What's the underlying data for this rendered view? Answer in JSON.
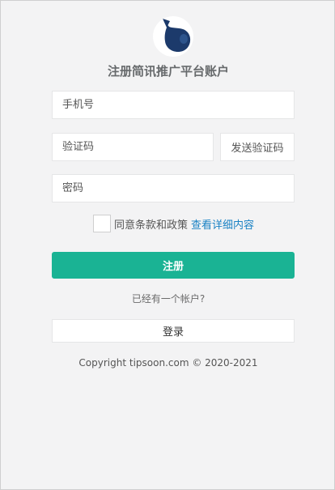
{
  "brand": {
    "logo_icon": "cat-silhouette-icon",
    "title": "注册简讯推广平台账户"
  },
  "form": {
    "phone_placeholder": "手机号",
    "code_placeholder": "验证码",
    "send_code_label": "发送验证码",
    "password_placeholder": "密码",
    "agree_text": "同意条款和政策",
    "terms_link": "查看详细内容",
    "agree_checked": false,
    "register_label": "注册"
  },
  "login": {
    "prompt": "已经有一个帐户?",
    "button_label": "登录"
  },
  "footer": {
    "copyright": "Copyright tipsoon.com © 2020-2021"
  },
  "colors": {
    "primary": "#1ab394",
    "link": "#1a82c4",
    "background": "#f3f3f4",
    "logo_cat": "#1c3a6b"
  }
}
